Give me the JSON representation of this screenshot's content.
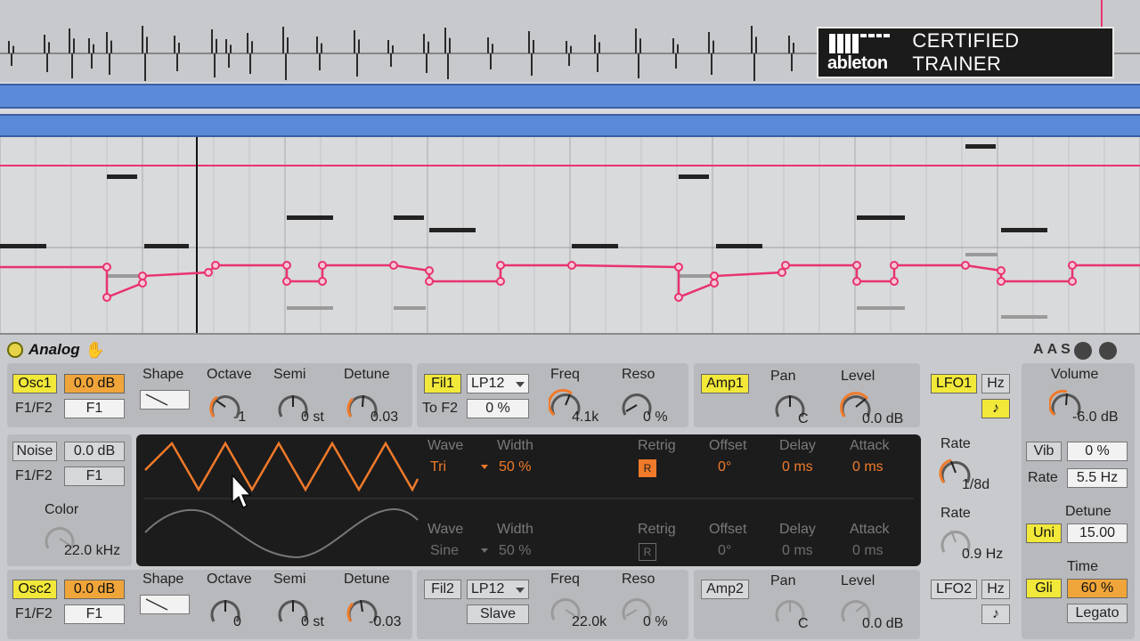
{
  "badge": {
    "logo_text": "ableton",
    "title": "CERTIFIED TRAINER"
  },
  "device": {
    "name": "Analog",
    "header_buttons": [
      "A",
      "A",
      "S"
    ]
  },
  "osc1": {
    "label": "Osc1",
    "gain": "0.0 dB",
    "routing_label": "F1/F2",
    "routing_value": "F1",
    "shape_label": "Shape",
    "octave_label": "Octave",
    "octave_value": "-1",
    "semi_label": "Semi",
    "semi_value": "0 st",
    "detune_label": "Detune",
    "detune_value": "0.03"
  },
  "fil1": {
    "label": "Fil1",
    "type": "LP12",
    "to_f2_label": "To F2",
    "to_f2_value": "0 %",
    "freq_label": "Freq",
    "freq_value": "4.1k",
    "reso_label": "Reso",
    "reso_value": "0 %"
  },
  "amp1": {
    "label": "Amp1",
    "pan_label": "Pan",
    "pan_value": "C",
    "level_label": "Level",
    "level_value": "0.0 dB"
  },
  "lfo1": {
    "label": "LFO1",
    "hz": "Hz",
    "sync_icon": "note-icon",
    "rate_label": "Rate",
    "rate_value": "1/8d"
  },
  "noise": {
    "label": "Noise",
    "gain": "0.0 dB",
    "routing_label": "F1/F2",
    "routing_value": "F1",
    "color_label": "Color",
    "color_value": "22.0 kHz"
  },
  "display": {
    "upper": {
      "wave_label": "Wave",
      "wave_value": "Tri",
      "width_label": "Width",
      "width_value": "50 %",
      "retrig_label": "Retrig",
      "retrig_btn": "R",
      "offset_label": "Offset",
      "offset_value": "0°",
      "delay_label": "Delay",
      "delay_value": "0 ms",
      "attack_label": "Attack",
      "attack_value": "0 ms"
    },
    "lower": {
      "wave_label": "Wave",
      "wave_value": "Sine",
      "width_label": "Width",
      "width_value": "50 %",
      "retrig_label": "Retrig",
      "retrig_btn": "R",
      "offset_label": "Offset",
      "offset_value": "0°",
      "delay_label": "Delay",
      "delay_value": "0 ms",
      "attack_label": "Attack",
      "attack_value": "0 ms"
    }
  },
  "lfo2": {
    "label": "LFO2",
    "hz": "Hz",
    "rate_label": "Rate",
    "rate_value": "0.9 Hz"
  },
  "osc2": {
    "label": "Osc2",
    "gain": "0.0 dB",
    "routing_label": "F1/F2",
    "routing_value": "F1",
    "shape_label": "Shape",
    "octave_label": "Octave",
    "octave_value": "0",
    "semi_label": "Semi",
    "semi_value": "0 st",
    "detune_label": "Detune",
    "detune_value": "-0.03"
  },
  "fil2": {
    "label": "Fil2",
    "type": "LP12",
    "slave": "Slave",
    "freq_label": "Freq",
    "freq_value": "22.0k",
    "reso_label": "Reso",
    "reso_value": "0 %"
  },
  "amp2": {
    "label": "Amp2",
    "pan_label": "Pan",
    "pan_value": "C",
    "level_label": "Level",
    "level_value": "0.0 dB"
  },
  "global": {
    "volume_label": "Volume",
    "volume_value": "-6.0 dB",
    "vib_label": "Vib",
    "vib_value": "0 %",
    "rate_label": "Rate",
    "rate_value": "5.5 Hz",
    "uni_label": "Uni",
    "detune_label": "Detune",
    "detune_value": "15.00",
    "gli_label": "Gli",
    "time_label": "Time",
    "time_value": "60 %",
    "legato_label": "Legato"
  },
  "colors": {
    "accent_orange": "#f07a2a",
    "active_yellow": "#f2e83a",
    "clip_blue": "#5b8bd8",
    "automation_pink": "#e8336f"
  }
}
